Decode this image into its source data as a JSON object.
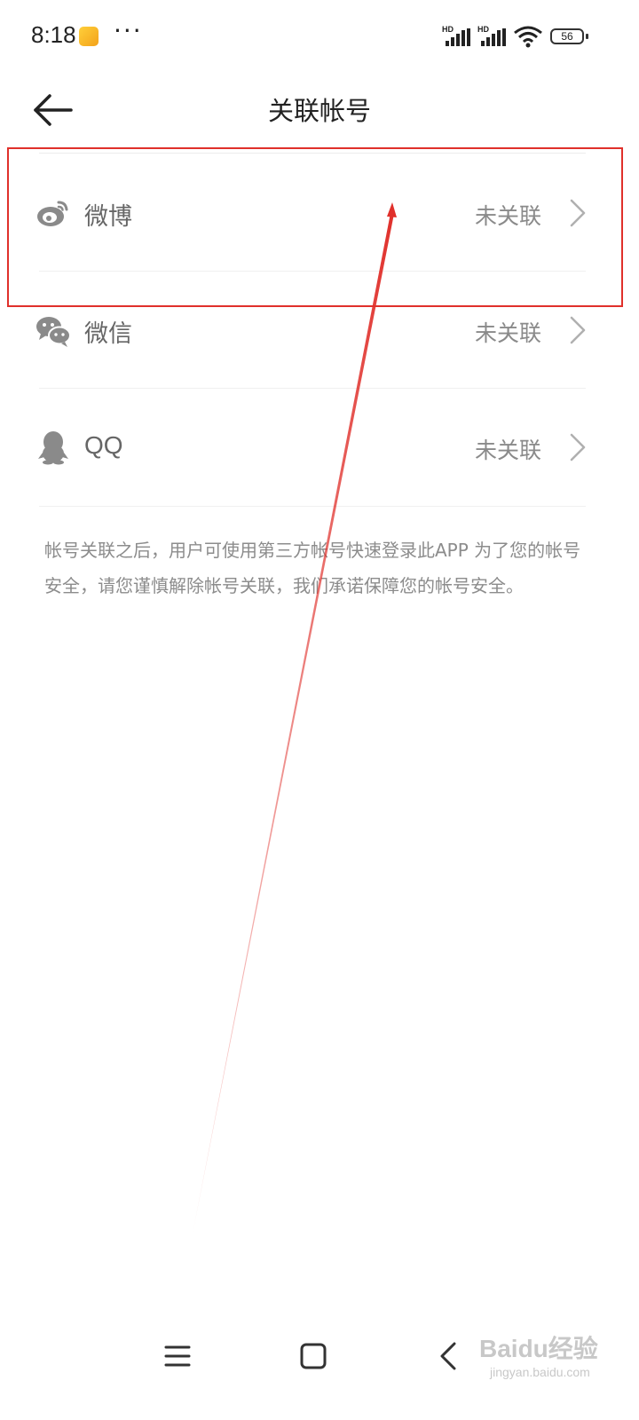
{
  "status_bar": {
    "time": "8:18",
    "more": "···",
    "signal_1_label": "HD",
    "signal_2_label": "HD",
    "battery": "56"
  },
  "header": {
    "title": "关联帐号"
  },
  "accounts": [
    {
      "label": "微博",
      "status": "未关联",
      "icon": "weibo-icon"
    },
    {
      "label": "微信",
      "status": "未关联",
      "icon": "wechat-icon"
    },
    {
      "label": "QQ",
      "status": "未关联",
      "icon": "qq-icon"
    }
  ],
  "note": "帐号关联之后，用户可使用第三方帐号快速登录此APP 为了您的帐号安全，请您谨慎解除帐号关联，我们承诺保障您的帐号安全。",
  "nav_bar": {
    "menu_icon": "menu-icon",
    "home_icon": "home-icon",
    "back_icon": "back-icon"
  },
  "watermark": {
    "brand": "Baidu经验",
    "url": "jingyan.baidu.com"
  },
  "colors": {
    "annotation": "#e0302b",
    "icon_gray": "#8a8a8a"
  }
}
